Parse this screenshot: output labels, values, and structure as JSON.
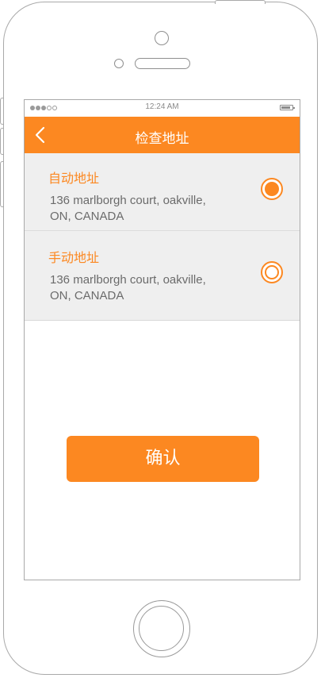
{
  "status_bar": {
    "time": "12:24 AM",
    "signal_icon": "signal-dots-icon",
    "battery_icon": "battery-icon"
  },
  "nav": {
    "title": "检查地址",
    "back_icon": "chevron-left-icon"
  },
  "addresses": [
    {
      "label": "自动地址",
      "address_line1": "136 marlborgh court, oakville,",
      "address_line2": "ON, CANADA",
      "selected": true
    },
    {
      "label": "手动地址",
      "address_line1": "136 marlborgh court, oakville,",
      "address_line2": "ON, CANADA",
      "selected": false
    }
  ],
  "confirm_label": "确认",
  "colors": {
    "accent": "#fc8821",
    "list_bg": "#efefef",
    "text_gray": "#6b6b6b"
  }
}
